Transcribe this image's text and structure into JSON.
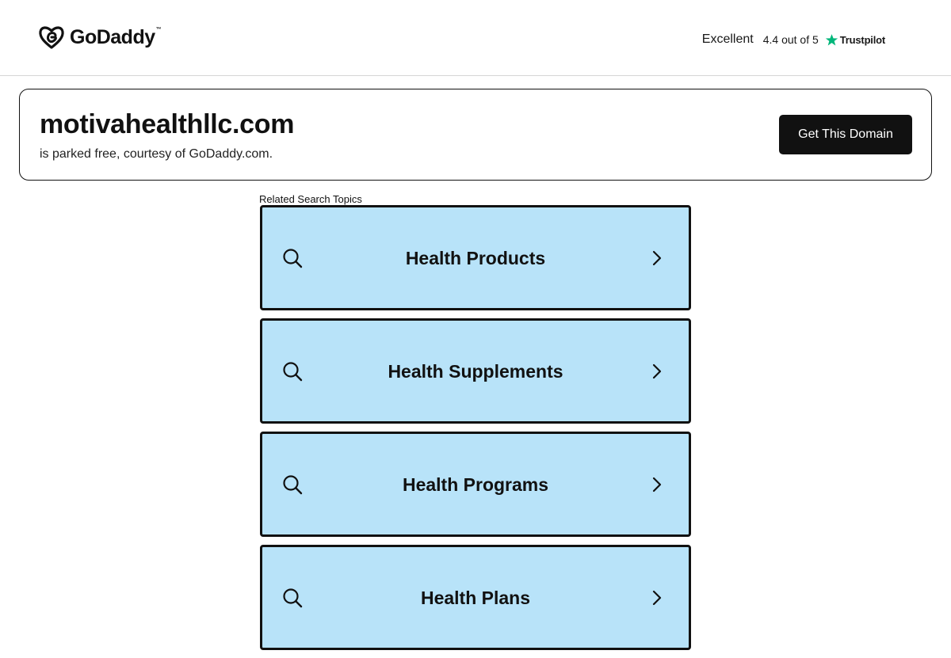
{
  "header": {
    "logo_text": "GoDaddy",
    "logo_tm": "™",
    "rating": {
      "label": "Excellent",
      "score_text": "4.4 out of 5",
      "provider": "Trustpilot",
      "star_color": "#00b67a"
    }
  },
  "domain_card": {
    "domain": "motivahealthllc.com",
    "subtitle": "is parked free, courtesy of GoDaddy.com.",
    "cta_label": "Get This Domain"
  },
  "related": {
    "label": "Related Search Topics",
    "tile_color": "#b8e3f9",
    "items": [
      {
        "label": "Health Products",
        "icon": "search-icon",
        "arrow": "chevron-right-icon"
      },
      {
        "label": "Health Supplements",
        "icon": "search-icon",
        "arrow": "chevron-right-icon"
      },
      {
        "label": "Health Programs",
        "icon": "search-icon",
        "arrow": "chevron-right-icon"
      },
      {
        "label": "Health Plans",
        "icon": "search-icon",
        "arrow": "chevron-right-icon"
      }
    ]
  }
}
